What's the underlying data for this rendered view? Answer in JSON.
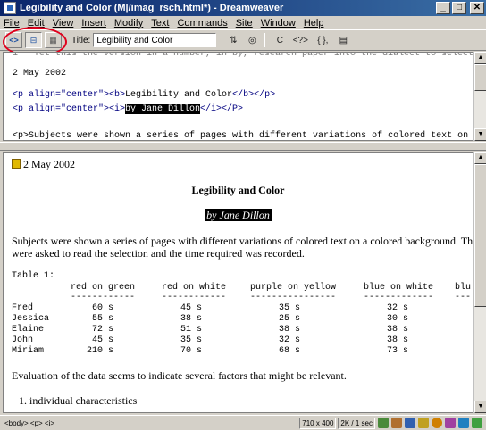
{
  "window": {
    "title": "Legibility and Color (M|/imag_rsch.html*) - Dreamweaver",
    "min_label": "_",
    "max_label": "□",
    "close_label": "✕"
  },
  "menu": [
    "File",
    "Edit",
    "View",
    "Insert",
    "Modify",
    "Text",
    "Commands",
    "Site",
    "Window",
    "Help"
  ],
  "toolbar": {
    "title_label": "Title:",
    "title_value": "Legibility and Color",
    "code_view_icon": "<>",
    "split_view_icon": "⊟",
    "design_view_icon": "▦",
    "file_mgmt_icon": "⇅",
    "preview_icon": "◎",
    "refresh_icon": "C",
    "reference_icon": "<?>",
    "nav_icon": "{ },",
    "options_icon": "▤"
  },
  "code": {
    "line_cut": "1   Yet this the version in a number, in by, research paper into the dialect to select",
    "line_date": "2 May 2002",
    "line_h_open": "<p align=\"center\"><b>",
    "line_h_text": "Legibility and Color",
    "line_h_close": "</b></p>",
    "line_a_open": "<p align=\"center\"><i>",
    "line_a_text": "by Jane Dillon",
    "line_a_close": "</i></P>",
    "line_sub": "<p>Subjects were shown a series of pages with different variations of colored text on"
  },
  "design": {
    "date": "2 May 2002",
    "heading": "Legibility and Color",
    "author": "by Jane Dillon",
    "para1_line1": "Subjects were shown a series of pages with different variations of colored text on a colored background. They",
    "para1_line2": "were asked to read the selection and the time required was recorded.",
    "table_caption": "Table 1:",
    "columns": [
      "red on green",
      "red on white",
      "purple on yellow",
      "blue on white",
      "blu"
    ],
    "underlines": [
      "------------",
      "------------",
      "----------------",
      "-------------",
      "---"
    ],
    "rows": [
      {
        "name": "Fred",
        "values": [
          "60 s",
          "45 s",
          "35 s",
          "32 s"
        ]
      },
      {
        "name": "Jessica",
        "values": [
          "55 s",
          "38 s",
          "25 s",
          "30 s"
        ]
      },
      {
        "name": "Elaine",
        "values": [
          "72 s",
          "51 s",
          "38 s",
          "38 s"
        ]
      },
      {
        "name": "John",
        "values": [
          "45 s",
          "35 s",
          "32 s",
          "38 s"
        ]
      },
      {
        "name": "Miriam",
        "values": [
          "210 s",
          "70 s",
          "68 s",
          "73 s"
        ]
      }
    ],
    "para2": "Evaluation of the data seems to indicate several factors that might be relevant.",
    "list_item1": "1.  individual characteristics"
  },
  "status": {
    "tag_selector": "<body> <p> <i>",
    "window_size": "710 x 400",
    "download": "2K / 1 sec"
  },
  "colors": {
    "title_start": "#0a246a",
    "title_end": "#3a6ea5",
    "highlight_circle": "#e0001c",
    "tag_color": "#000080"
  }
}
